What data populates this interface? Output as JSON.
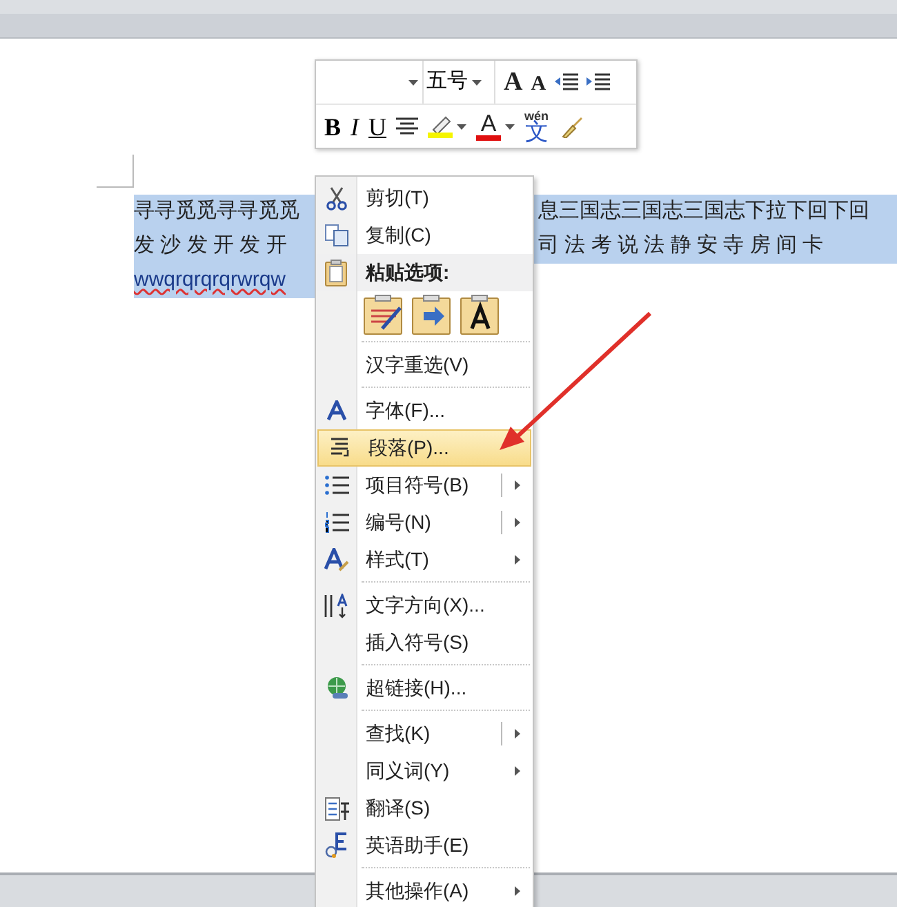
{
  "mini_toolbar": {
    "font_size_field": {
      "value": "五号"
    },
    "row_1": [
      {
        "kind": "grow_font",
        "text": "A"
      },
      {
        "kind": "shrink_font",
        "text": "A"
      },
      {
        "kind": "outdent"
      },
      {
        "kind": "indent"
      }
    ],
    "row_2": [
      {
        "kind": "bold",
        "text": "B"
      },
      {
        "kind": "italic",
        "text": "I"
      },
      {
        "kind": "underline",
        "text": "U"
      },
      {
        "kind": "center"
      },
      {
        "kind": "highlight",
        "color": "#f5f500"
      },
      {
        "kind": "caret"
      },
      {
        "kind": "font_color",
        "text": "A",
        "color": "#e01010"
      },
      {
        "kind": "caret"
      },
      {
        "kind": "phonetic",
        "text": "wén",
        "base": "文"
      },
      {
        "kind": "format_painter"
      }
    ]
  },
  "document": {
    "lines": [
      {
        "left": "寻寻觅觅寻寻觅觅",
        "right": "息三国志三国志三国志下拉下回下回",
        "selected": true
      },
      {
        "left": "发 沙 发 开 发 开",
        "right": "司 法 考 说 法 静 安 寺 房 间 卡",
        "selected": true
      },
      {
        "left": "wwqrqrqrqrwrqw",
        "selected": true
      }
    ]
  },
  "context_menu": {
    "items": [
      {
        "kind": "command",
        "label": "剪切(T)",
        "selected": false,
        "submenu": false,
        "split": false
      },
      {
        "kind": "command",
        "label": "复制(C)",
        "selected": false,
        "submenu": false,
        "split": false
      },
      {
        "kind": "header",
        "label": "粘贴选项:"
      },
      {
        "kind": "paste_options"
      },
      {
        "kind": "separator"
      },
      {
        "kind": "command",
        "label": "汉字重选(V)",
        "selected": false,
        "submenu": false,
        "split": false
      },
      {
        "kind": "separator"
      },
      {
        "kind": "command",
        "label": "字体(F)...",
        "selected": false,
        "submenu": false,
        "split": false
      },
      {
        "kind": "command",
        "label": "段落(P)...",
        "selected": true,
        "submenu": false,
        "split": false
      },
      {
        "kind": "command",
        "label": "项目符号(B)",
        "selected": false,
        "submenu": true,
        "split": true
      },
      {
        "kind": "command",
        "label": "编号(N)",
        "selected": false,
        "submenu": true,
        "split": true
      },
      {
        "kind": "command",
        "label": "样式(T)",
        "selected": false,
        "submenu": true,
        "split": false
      },
      {
        "kind": "separator"
      },
      {
        "kind": "command",
        "label": "文字方向(X)...",
        "selected": false,
        "submenu": false,
        "split": false
      },
      {
        "kind": "command",
        "label": "插入符号(S)",
        "selected": false,
        "submenu": false,
        "split": false
      },
      {
        "kind": "separator"
      },
      {
        "kind": "command",
        "label": "超链接(H)...",
        "selected": false,
        "submenu": false,
        "split": false
      },
      {
        "kind": "separator"
      },
      {
        "kind": "command",
        "label": "查找(K)",
        "selected": false,
        "submenu": true,
        "split": true
      },
      {
        "kind": "command",
        "label": "同义词(Y)",
        "selected": false,
        "submenu": true,
        "split": false
      },
      {
        "kind": "command",
        "label": "翻译(S)",
        "selected": false,
        "submenu": false,
        "split": false
      },
      {
        "kind": "command",
        "label": "英语助手(E)",
        "selected": false,
        "submenu": false,
        "split": false
      },
      {
        "kind": "separator"
      },
      {
        "kind": "command",
        "label": "其他操作(A)",
        "selected": false,
        "submenu": true,
        "split": false
      }
    ]
  }
}
